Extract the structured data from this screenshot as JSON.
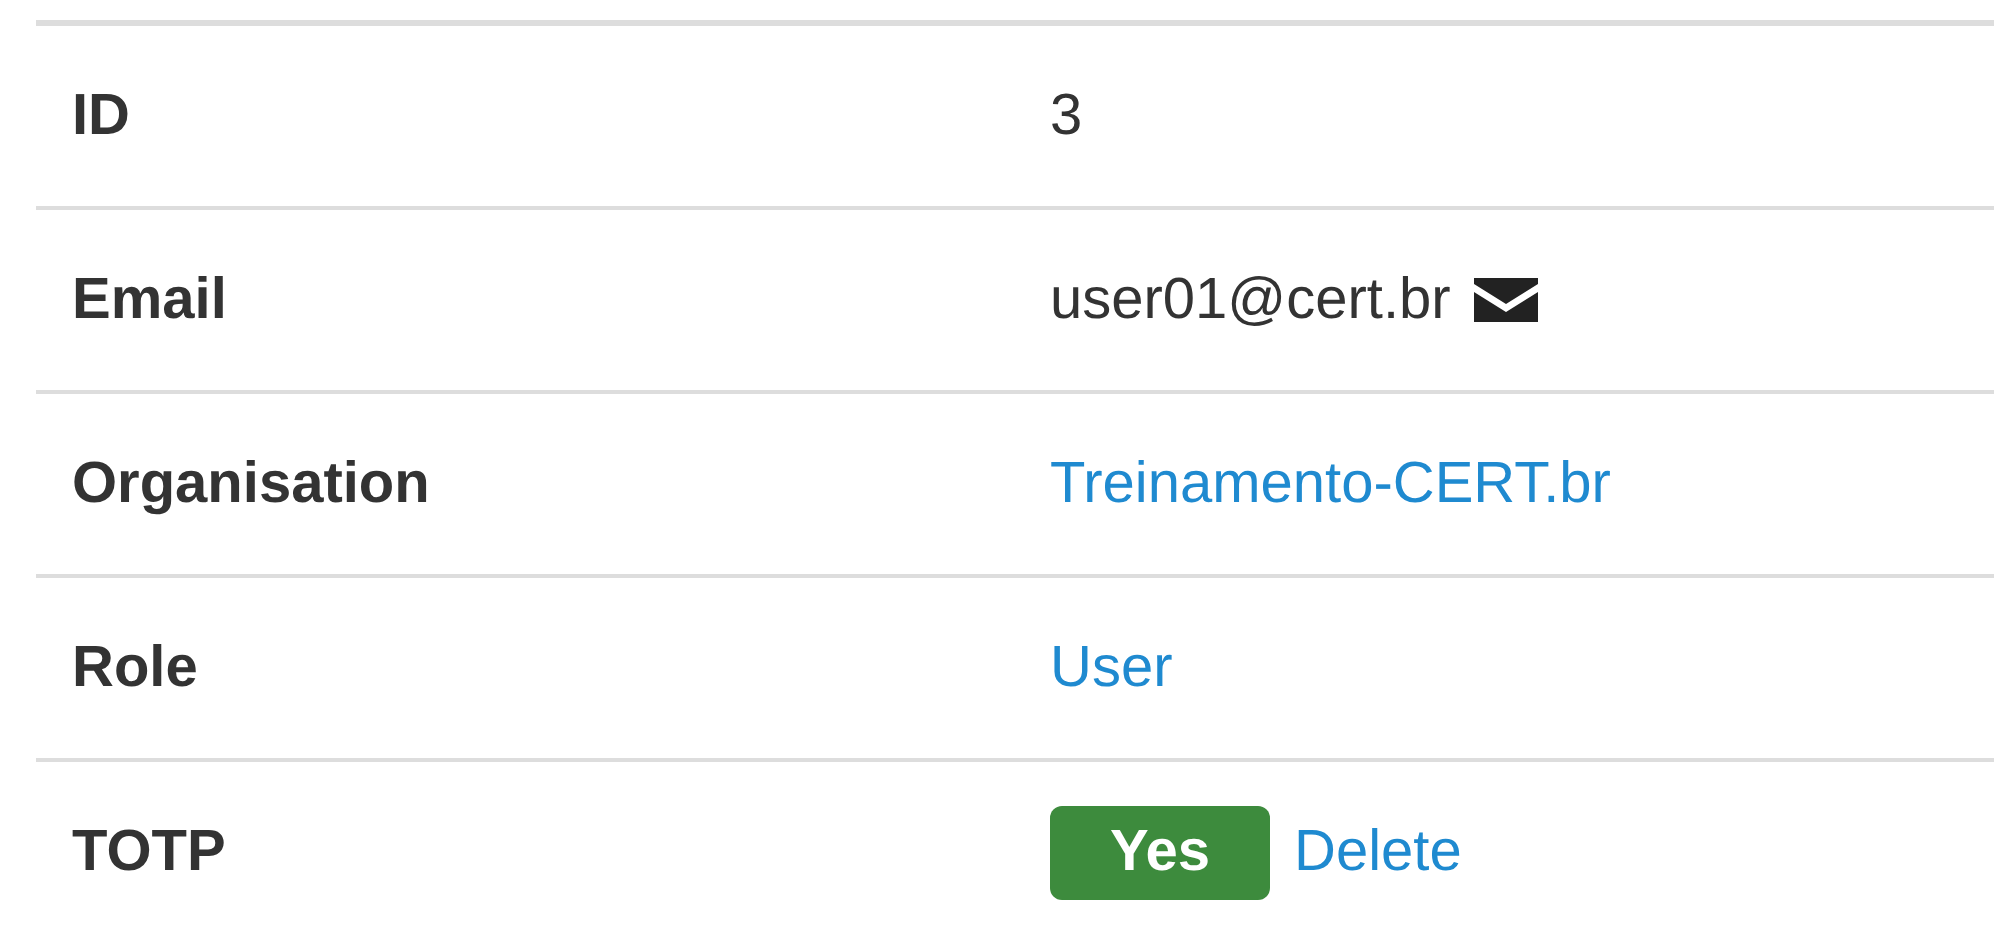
{
  "rows": [
    {
      "label": "ID",
      "kind": "text",
      "value": "3"
    },
    {
      "label": "Email",
      "kind": "email",
      "value": "user01@cert.br"
    },
    {
      "label": "Organisation",
      "kind": "link",
      "value": "Treinamento-CERT.br"
    },
    {
      "label": "Role",
      "kind": "link",
      "value": "User"
    },
    {
      "label": "TOTP",
      "kind": "badge",
      "badge": "Yes",
      "action": "Delete"
    }
  ]
}
